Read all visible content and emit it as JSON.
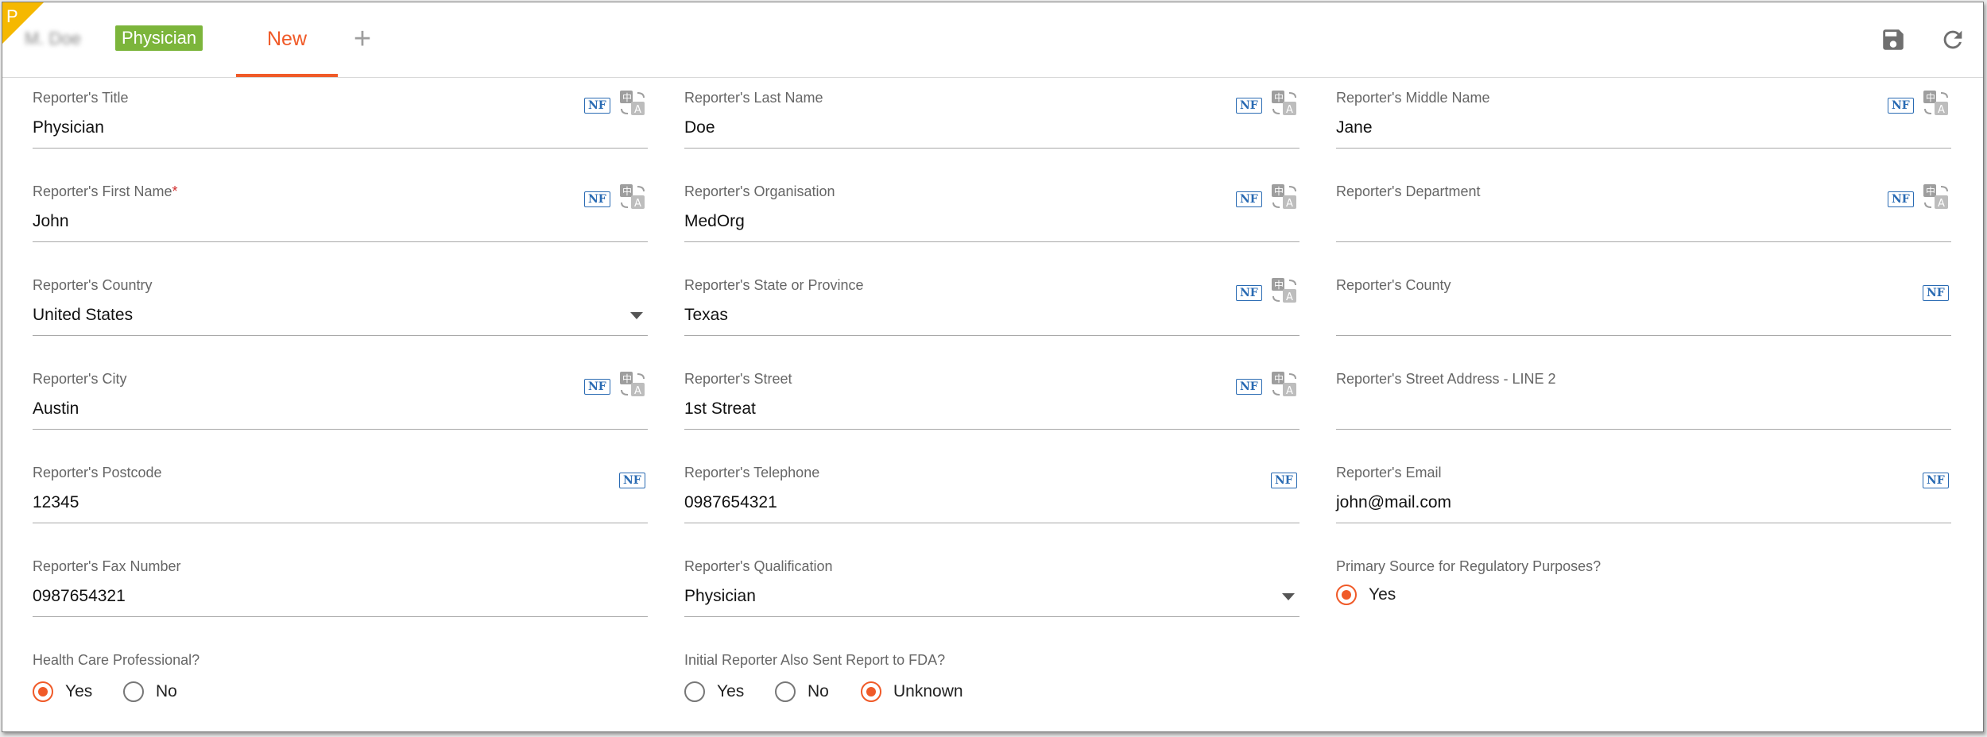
{
  "header": {
    "record_name": "M. Doe",
    "corner_letter": "P",
    "badge": "Physician",
    "tab_new": "New",
    "tab_add": "+"
  },
  "fields": {
    "title": {
      "label": "Reporter's Title",
      "value": "Physician"
    },
    "last_name": {
      "label": "Reporter's Last Name",
      "value": "Doe"
    },
    "middle_name": {
      "label": "Reporter's Middle Name",
      "value": "Jane"
    },
    "first_name": {
      "label": "Reporter's First Name",
      "required": "*",
      "value": "John"
    },
    "organisation": {
      "label": "Reporter's Organisation",
      "value": "MedOrg"
    },
    "department": {
      "label": "Reporter's Department",
      "value": ""
    },
    "country": {
      "label": "Reporter's Country",
      "value": "United States"
    },
    "state": {
      "label": "Reporter's State or Province",
      "value": "Texas"
    },
    "county": {
      "label": "Reporter's County",
      "value": ""
    },
    "city": {
      "label": "Reporter's City",
      "value": "Austin"
    },
    "street": {
      "label": "Reporter's Street",
      "value": "1st Streat"
    },
    "street2": {
      "label": "Reporter's Street Address - LINE 2",
      "value": ""
    },
    "postcode": {
      "label": "Reporter's Postcode",
      "value": "12345"
    },
    "telephone": {
      "label": "Reporter's Telephone",
      "value": "0987654321"
    },
    "email": {
      "label": "Reporter's Email",
      "value": "john@mail.com"
    },
    "fax": {
      "label": "Reporter's Fax Number",
      "value": "0987654321"
    },
    "qualification": {
      "label": "Reporter's Qualification",
      "value": "Physician"
    }
  },
  "nf_badge": "NF",
  "primary_source": {
    "label": "Primary Source for Regulatory Purposes?",
    "options": [
      "Yes"
    ],
    "selected": "Yes"
  },
  "hcp": {
    "label": "Health Care Professional?",
    "options": [
      "Yes",
      "No"
    ],
    "selected": "Yes"
  },
  "fda": {
    "label": "Initial Reporter Also Sent Report to FDA?",
    "options": [
      "Yes",
      "No",
      "Unknown"
    ],
    "selected": "Unknown"
  },
  "colors": {
    "accent": "#f05a28",
    "badge": "#7cb53b",
    "nf": "#2a6bb3",
    "corner": "#f5b800"
  },
  "icons": [
    "save-icon",
    "refresh-icon",
    "translate-icon",
    "dropdown-caret-icon"
  ]
}
